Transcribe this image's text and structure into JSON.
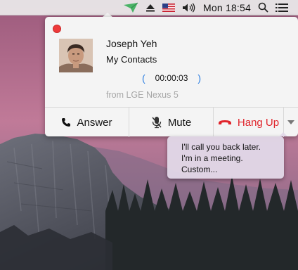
{
  "menubar": {
    "clock": "Mon 18:54",
    "icons": [
      "pushbullet-icon",
      "eject-icon",
      "flag-us-icon",
      "volume-icon",
      "search-icon",
      "list-icon"
    ]
  },
  "call": {
    "caller_name": "Joseph Yeh",
    "caller_group": "My Contacts",
    "timer": "00:00:03",
    "source": "from LGE Nexus 5",
    "actions": {
      "answer": "Answer",
      "mute": "Mute",
      "hangup": "Hang Up"
    }
  },
  "quick_replies": [
    "I'll call you back later.",
    "I'm in a meeting.",
    "Custom..."
  ],
  "colors": {
    "close_dot": "#ee3a3a",
    "hangup": "#e0242b",
    "timer_paren": "#2a7de1",
    "pushbullet": "#4ab367"
  }
}
